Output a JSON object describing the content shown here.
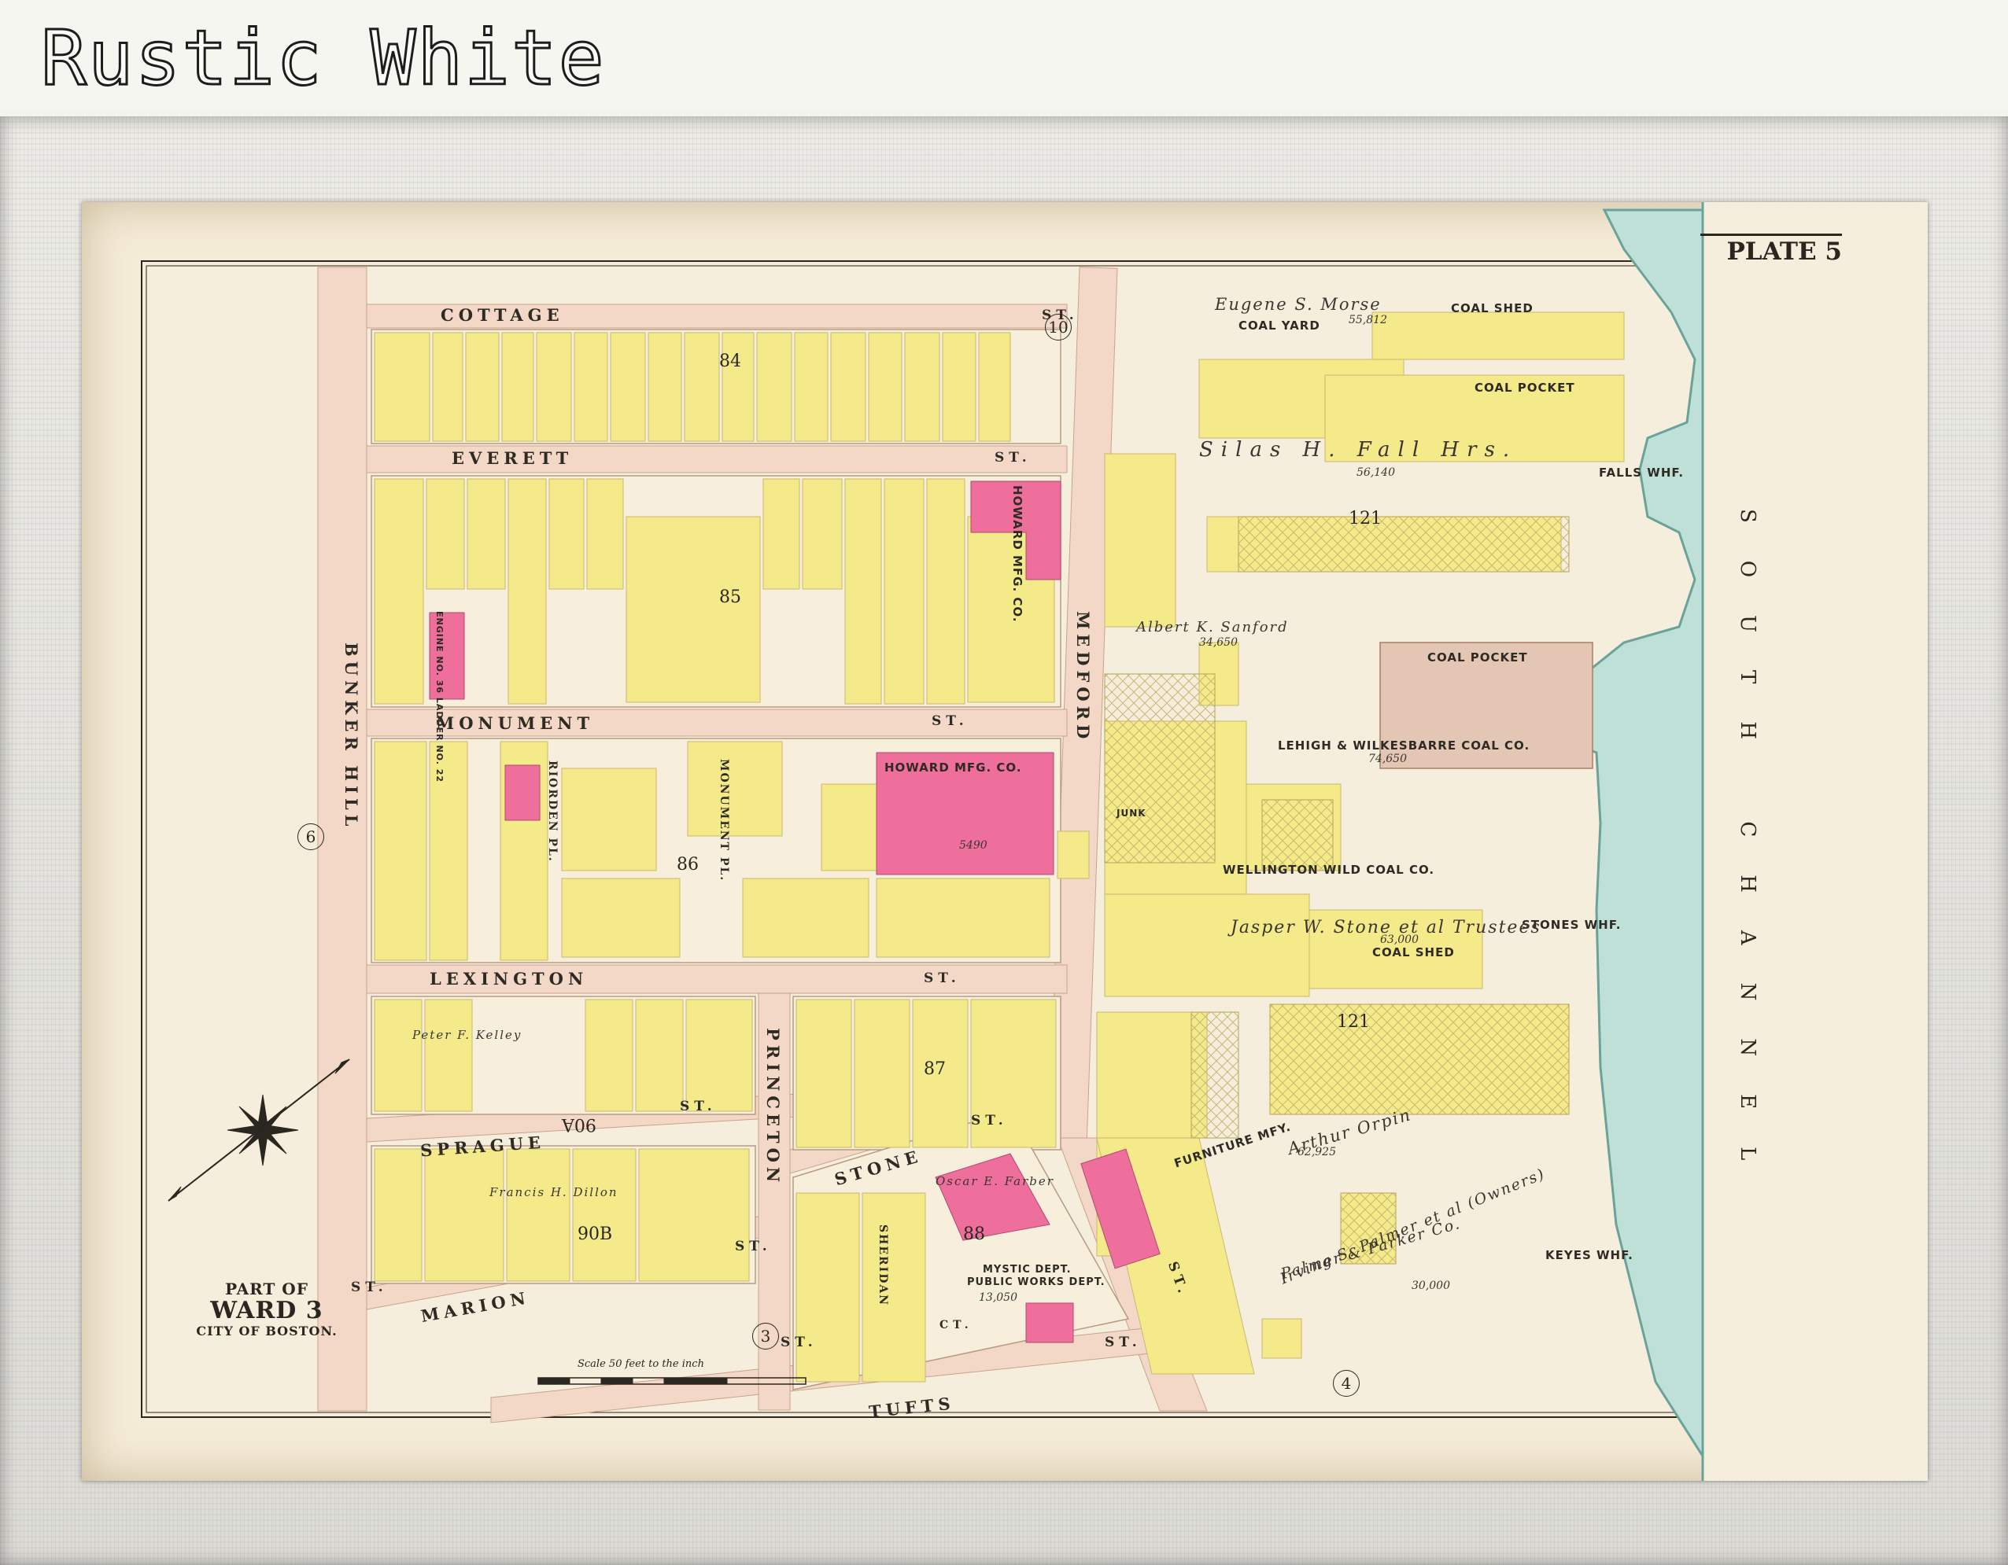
{
  "banner": {
    "title": "Rustic White"
  },
  "map": {
    "plate": "PLATE 5",
    "ward": {
      "part": "PART OF",
      "name": "WARD 3",
      "city": "CITY OF BOSTON."
    },
    "scale_caption": "Scale 50 feet to the inch",
    "channel_label": "SOUTH CHANNEL",
    "streets": {
      "cottage": "COTTAGE",
      "everett": "EVERETT",
      "monument": "MONUMENT",
      "lexington": "LEXINGTON",
      "sprague": "SPRAGUE",
      "marion": "MARION",
      "tufts": "TUFTS",
      "stone": "STONE",
      "st_1": "ST.",
      "st_2": "ST.",
      "st_3": "ST.",
      "st_4": "ST.",
      "st_5": "ST.",
      "st_6": "ST.",
      "st_7": "ST.",
      "st_8": "ST.",
      "st_9": "ST.",
      "st_10": "ST.",
      "st_11": "ST.",
      "bunker_hill": "BUNKER HILL",
      "medford": "MEDFORD",
      "princeton": "PRINCETON",
      "riorden_pl": "RIORDEN PL.",
      "monument_pl": "MONUMENT PL.",
      "sheridan": "SHERIDAN",
      "ct": "CT."
    },
    "wharves": {
      "falls": "FALLS WHF.",
      "stones": "STONES WHF.",
      "keyes": "KEYES WHF."
    },
    "buildings": {
      "coal_shed_1": "COAL SHED",
      "coal_yard": "COAL YARD",
      "coal_pocket_1": "COAL POCKET",
      "coal_pocket_2": "COAL POCKET",
      "coal_shed_2": "COAL SHED",
      "howard_1": "HOWARD MFG. CO.",
      "howard_2": "HOWARD MFG. CO.",
      "lehigh": "LEHIGH & WILKESBARRE COAL CO.",
      "wellington": "WELLINGTON WILD COAL CO.",
      "furniture": "FURNITURE MFY.",
      "mystic": "MYSTIC DEPT.",
      "public_works": "PUBLIC WORKS DEPT.",
      "junk": "JUNK",
      "engine": "ENGINE NO. 36 LADDER NO. 22"
    },
    "owners": {
      "morse": "Eugene S. Morse",
      "pratt": "Silas H. Fall Hrs.",
      "sanford": "Albert K. Sanford",
      "stone": "Jasper W. Stone et al Trustees",
      "orpin": "Arthur Orpin",
      "palmer_parker": "Palmer & Parker Co.",
      "palmer_owners": "Irving S. Palmer et al (Owners)",
      "farber": "Oscar E. Farber",
      "dillon": "Francis H. Dillon",
      "kelly": "Peter F. Kelley"
    },
    "areas": {
      "morse": "55,812",
      "pratt": "56,140",
      "sanford": "34,650",
      "lehigh": "74,650",
      "stone": "63,000",
      "orpin": "62,925",
      "palmer": "30,000",
      "howard": "5490",
      "mystic": "13,050"
    },
    "block_numbers": {
      "b10": "10",
      "b84": "84",
      "b85": "85",
      "b86": "86",
      "b87": "87",
      "b88": "88",
      "b90a": "90A",
      "b90b": "90B",
      "b121a": "121",
      "b121b": "121"
    },
    "circled": {
      "c3": "3",
      "c4": "4",
      "c6": "6"
    },
    "colors": {
      "paper": "#f5ecd8",
      "street": "#f2d7c6",
      "building_yellow": "#f4ea8a",
      "building_pink": "#ee6e9c",
      "water": "#b9dcd3",
      "coal_pocket_brown": "#e4c6b4"
    }
  }
}
